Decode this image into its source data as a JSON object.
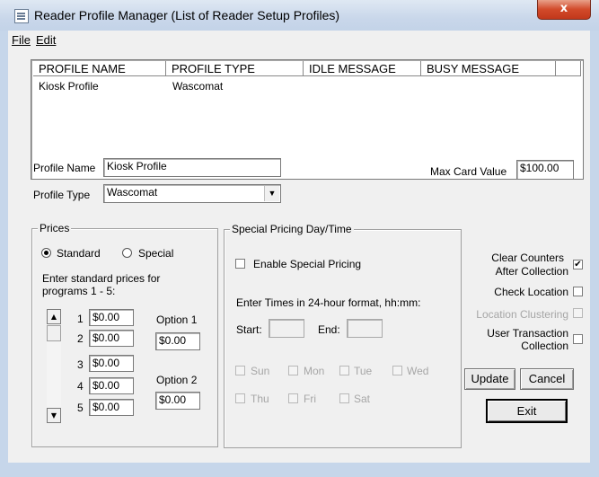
{
  "window": {
    "title": "Reader Profile Manager (List of Reader Setup Profiles)",
    "close_label": "x"
  },
  "menu": {
    "file": "File",
    "edit": "Edit"
  },
  "list": {
    "columns": [
      "PROFILE NAME",
      "PROFILE TYPE",
      "IDLE MESSAGE",
      "BUSY MESSAGE"
    ],
    "rows": [
      {
        "name": "Kiosk Profile",
        "type": "Wascomat",
        "idle": "",
        "busy": ""
      }
    ]
  },
  "profile": {
    "name_label": "Profile Name",
    "name_value": "Kiosk Profile",
    "type_label": "Profile Type",
    "type_value": "Wascomat",
    "max_card_label": "Max Card Value",
    "max_card_value": "$100.00"
  },
  "prices": {
    "title": "Prices",
    "standard_label": "Standard",
    "special_label": "Special",
    "selected": "Standard",
    "instructions_line1": "Enter standard prices for",
    "instructions_line2": "programs 1 - 5:",
    "programs": [
      {
        "num": "1",
        "value": "$0.00"
      },
      {
        "num": "2",
        "value": "$0.00"
      },
      {
        "num": "3",
        "value": "$0.00"
      },
      {
        "num": "4",
        "value": "$0.00"
      },
      {
        "num": "5",
        "value": "$0.00"
      }
    ],
    "option1_label": "Option 1",
    "option1_value": "$0.00",
    "option2_label": "Option 2",
    "option2_value": "$0.00"
  },
  "special_pricing": {
    "title": "Special Pricing Day/Time",
    "enable_label": "Enable Special Pricing",
    "enabled": false,
    "times_note": "Enter Times in 24-hour format, hh:mm:",
    "start_label": "Start:",
    "end_label": "End:",
    "days_row1": [
      "Sun",
      "Mon",
      "Tue",
      "Wed"
    ],
    "days_row2": [
      "Thu",
      "Fri",
      "Sat"
    ]
  },
  "options": {
    "clear_counters_line1": "Clear Counters",
    "clear_counters_line2": "After Collection",
    "clear_counters_checked": true,
    "check_location": "Check Location",
    "check_location_checked": false,
    "location_clustering": "Location Clustering",
    "location_clustering_checked": false,
    "user_transaction_line1": "User Transaction",
    "user_transaction_line2": "Collection",
    "user_transaction_checked": false
  },
  "buttons": {
    "update": "Update",
    "cancel": "Cancel",
    "exit": "Exit"
  }
}
